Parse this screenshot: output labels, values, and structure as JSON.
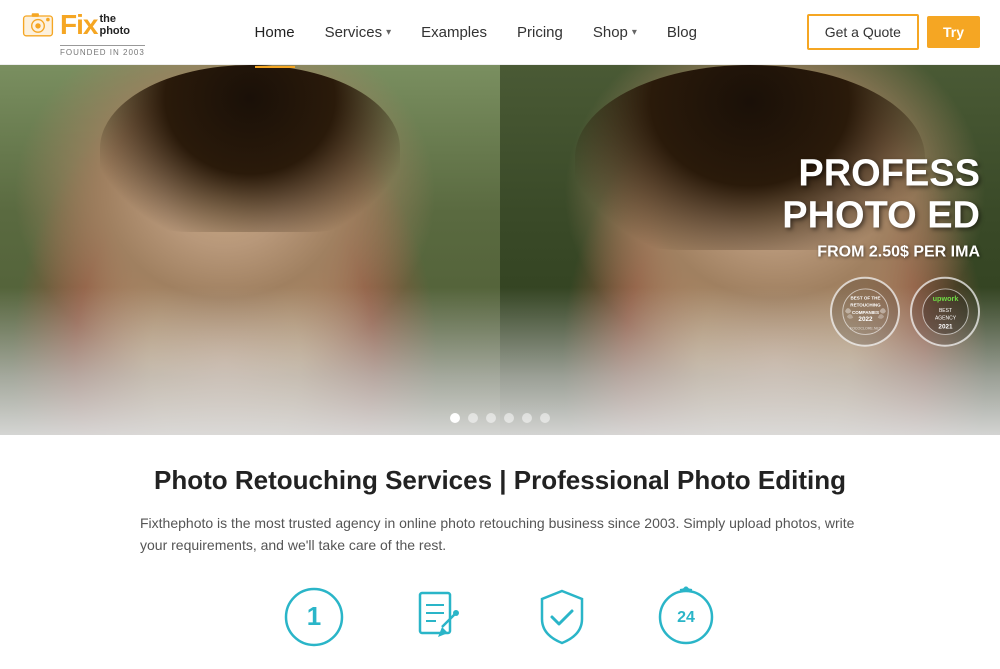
{
  "header": {
    "logo": {
      "fix_text": "Fix",
      "the_photo_text": "the\nphoto",
      "founded_text": "FOUNDED IN 2003"
    },
    "nav": {
      "items": [
        {
          "label": "Home",
          "active": true,
          "has_dropdown": false
        },
        {
          "label": "Services",
          "active": false,
          "has_dropdown": true
        },
        {
          "label": "Examples",
          "active": false,
          "has_dropdown": false
        },
        {
          "label": "Pricing",
          "active": false,
          "has_dropdown": false
        },
        {
          "label": "Shop",
          "active": false,
          "has_dropdown": true
        },
        {
          "label": "Blog",
          "active": false,
          "has_dropdown": false
        }
      ]
    },
    "buttons": {
      "quote_label": "Get a Quote",
      "try_label": "Try"
    }
  },
  "hero": {
    "title_line1": "PROFESS",
    "title_line2": "PHOTO ED",
    "subtitle": "FROM 2.50$ PER IMA",
    "badge1": {
      "line1": "BEST OF THE",
      "line2": "RETOUCHING",
      "line3": "COMPANIES",
      "line4": "2022",
      "line5": "FOCOCLORE.NET"
    },
    "badge2": {
      "line1": "upwork",
      "line2": "BEST AGENCY",
      "line3": "2021"
    },
    "dots_count": 6,
    "active_dot": 0
  },
  "content": {
    "title": "Photo Retouching Services | Professional Photo Editing",
    "description": "Fixthephoto is the most trusted agency in online photo retouching business since 2003. Simply upload photos, write your requirements, and we'll take care of the rest.",
    "features": [
      {
        "icon": "number-1-circle",
        "label": ""
      },
      {
        "icon": "document-edit",
        "label": ""
      },
      {
        "icon": "shield-check",
        "label": ""
      },
      {
        "icon": "clock-24",
        "label": ""
      }
    ]
  },
  "colors": {
    "accent": "#f5a623",
    "teal": "#2ab5c8",
    "dark": "#222222",
    "text": "#555555"
  }
}
